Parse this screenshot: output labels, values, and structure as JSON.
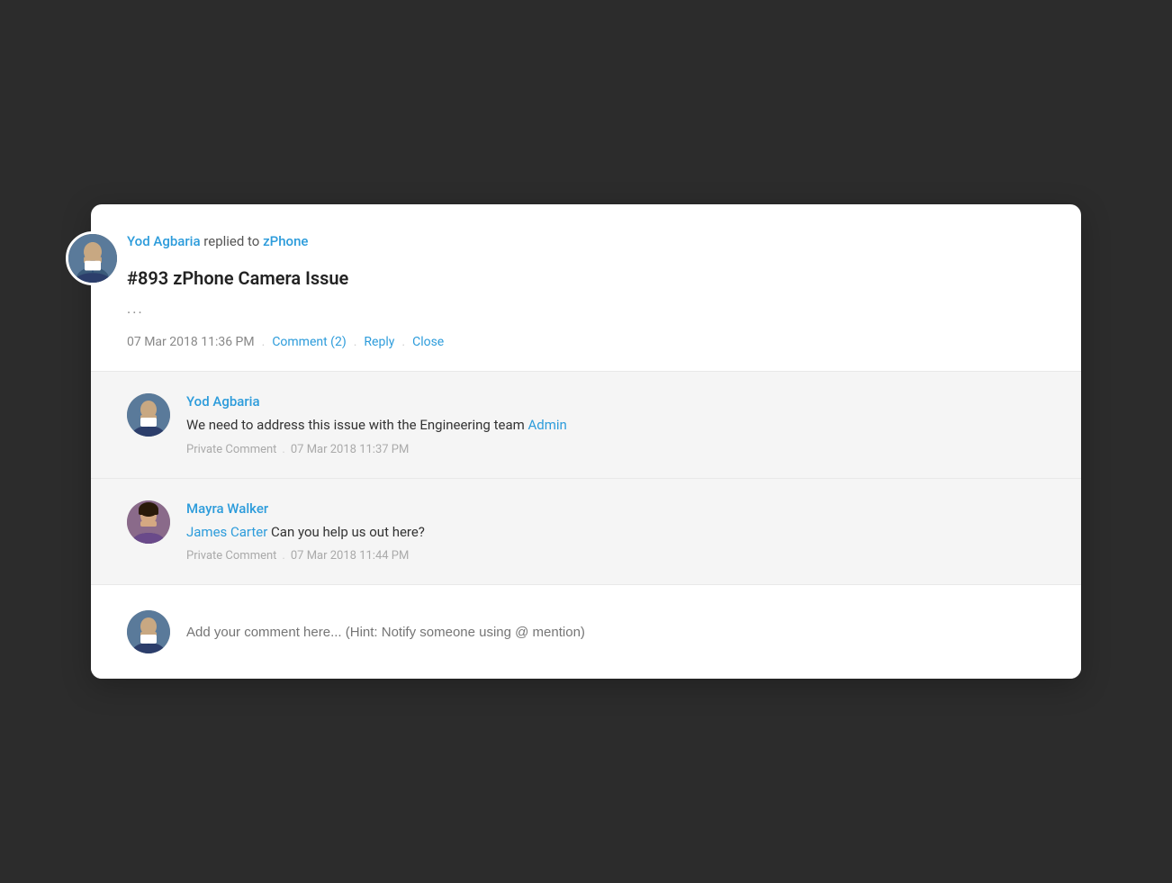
{
  "header": {
    "author_name": "Yod Agbaria",
    "replied_text": "replied to",
    "channel_name": "zPhone",
    "ticket_id": "#893",
    "ticket_title": "zPhone Camera Issue",
    "ellipsis": "...",
    "timestamp": "07 Mar 2018 11:36 PM",
    "comment_label": "Comment (2)",
    "reply_label": "Reply",
    "close_label": "Close",
    "dot": "."
  },
  "comments": [
    {
      "author": "Yod Agbaria",
      "text_before": "We need to address this issue with the Engineering team",
      "mention": "Admin",
      "text_after": "",
      "type": "Private Comment",
      "timestamp": "07 Mar 2018 11:37 PM"
    },
    {
      "author": "Mayra Walker",
      "mention_name": "James Carter",
      "text_after": "Can you help us out here?",
      "text_before": "",
      "type": "Private Comment",
      "timestamp": "07 Mar 2018 11:44 PM"
    }
  ],
  "add_comment": {
    "placeholder": "Add your comment here... (Hint: Notify someone using @ mention)"
  }
}
